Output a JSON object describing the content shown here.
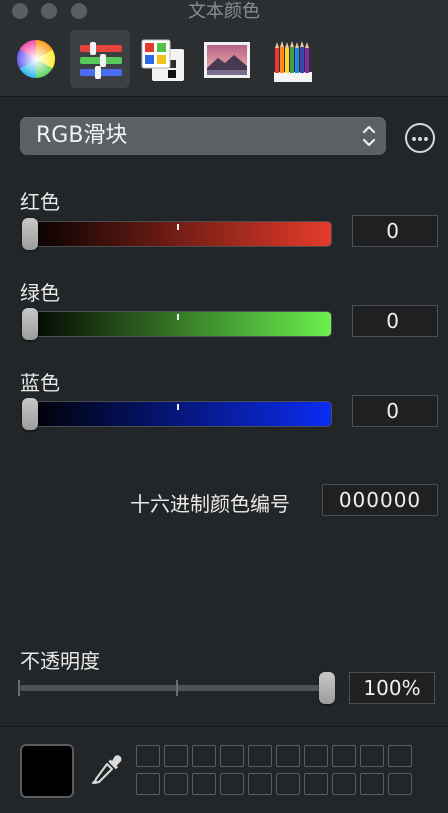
{
  "window": {
    "title": "文本颜色"
  },
  "toolbar": {
    "tabs": [
      {
        "icon": "color-wheel-icon",
        "selected": false
      },
      {
        "icon": "color-sliders-icon",
        "selected": true
      },
      {
        "icon": "color-palettes-icon",
        "selected": false
      },
      {
        "icon": "image-palettes-icon",
        "selected": false
      },
      {
        "icon": "pencils-icon",
        "selected": false
      }
    ]
  },
  "mode_select": {
    "label": "RGB滑块"
  },
  "sliders": {
    "red": {
      "label": "红色",
      "value": "0",
      "color": "#e63b2a"
    },
    "green": {
      "label": "绿色",
      "value": "0",
      "color": "#6cf04e"
    },
    "blue": {
      "label": "蓝色",
      "value": "0",
      "color": "#0b2cf3"
    }
  },
  "hex": {
    "label": "十六进制颜色编号",
    "value": "000000"
  },
  "opacity": {
    "label": "不透明度",
    "value": "100%",
    "level": 1.0
  },
  "current_color": {
    "color": "#000000"
  }
}
